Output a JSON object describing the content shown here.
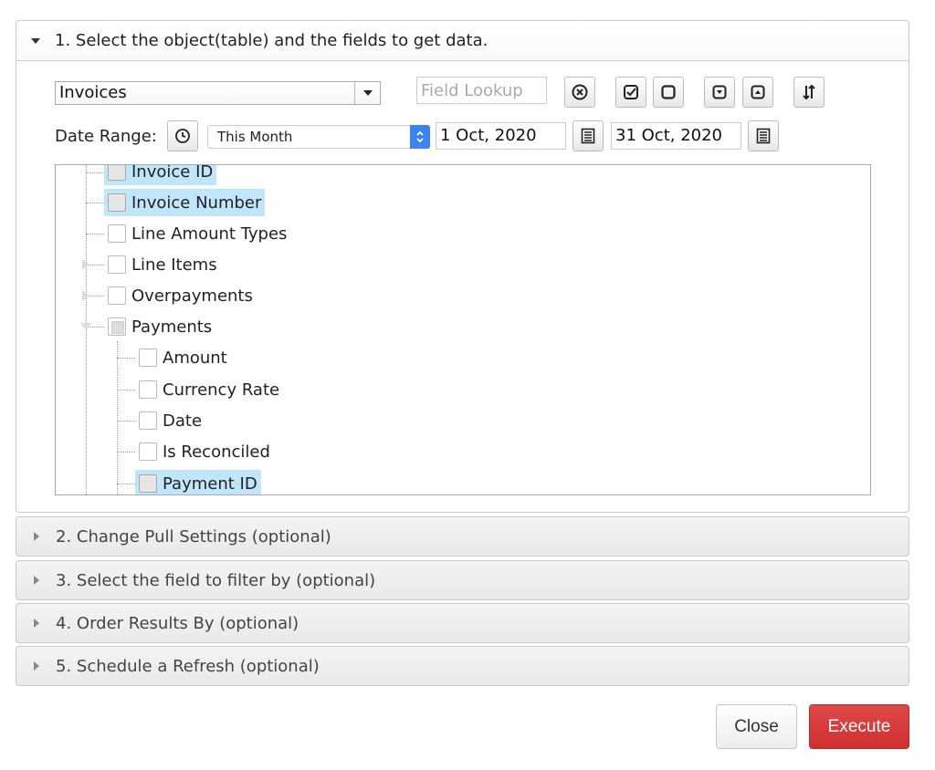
{
  "sections": {
    "s1_title": "1. Select the object(table) and the fields to get data.",
    "s2_title": "2. Change Pull Settings (optional)",
    "s3_title": "3. Select the field to filter by (optional)",
    "s4_title": "4. Order Results By (optional)",
    "s5_title": "5. Schedule a Refresh (optional)"
  },
  "object_select": {
    "value": "Invoices"
  },
  "field_lookup": {
    "placeholder": "Field Lookup"
  },
  "toolbar_icons": [
    "clear-icon",
    "check-all-icon",
    "uncheck-all-icon",
    "collapse-down-icon",
    "expand-up-icon",
    "sort-icon"
  ],
  "date_range": {
    "label": "Date Range:",
    "range_value": "This Month",
    "start": "1 Oct, 2020",
    "end": "31 Oct, 2020"
  },
  "tree": {
    "invoice_id": "Invoice ID",
    "invoice_number": "Invoice Number",
    "line_amount_types": "Line Amount Types",
    "line_items": "Line Items",
    "overpayments": "Overpayments",
    "payments": "Payments",
    "amount": "Amount",
    "currency_rate": "Currency Rate",
    "date": "Date",
    "is_reconciled": "Is Reconciled",
    "payment_id": "Payment ID"
  },
  "buttons": {
    "close": "Close",
    "execute": "Execute"
  },
  "colors": {
    "execute": "#d9383a",
    "selected_row": "#bfe6fb",
    "spinner": "#3b82f6"
  }
}
